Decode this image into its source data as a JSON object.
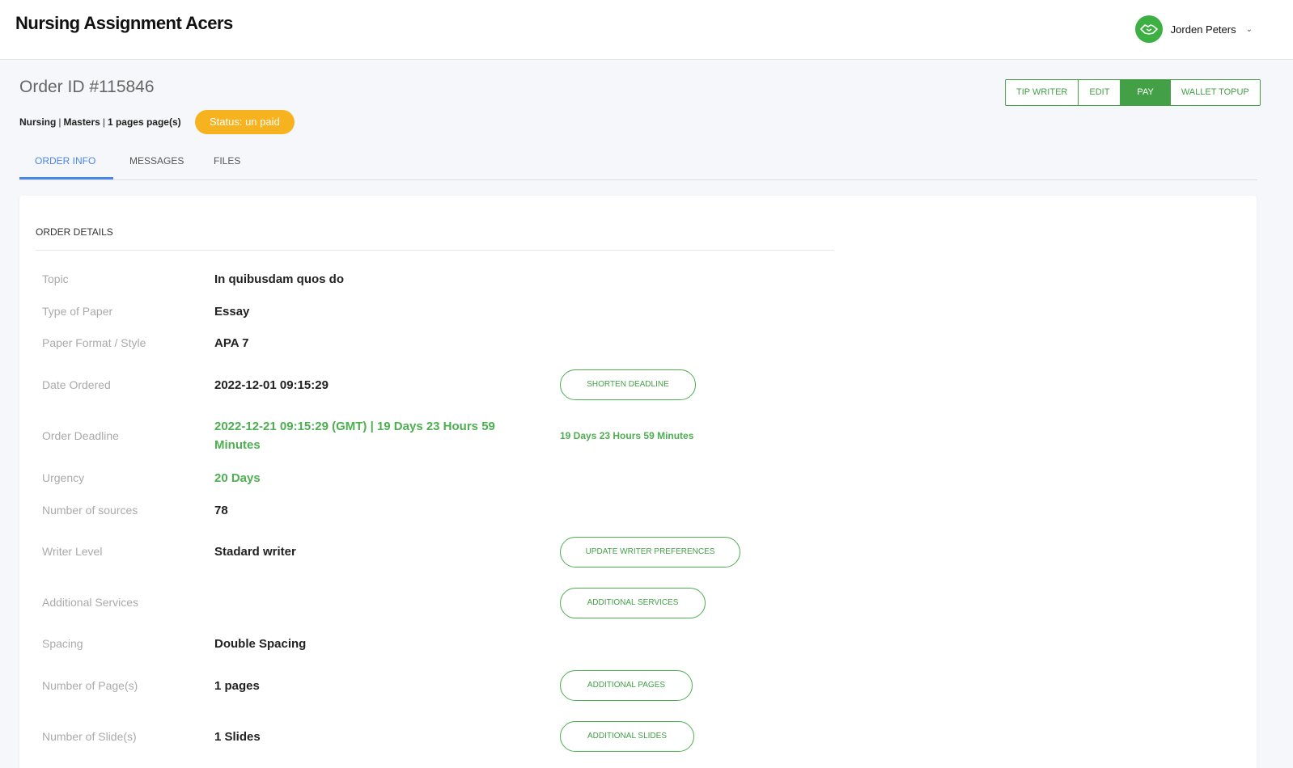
{
  "header": {
    "brand": "Nursing Assignment Acers",
    "user_name": "Jorden Peters",
    "avatar_icon": "handshake-icon",
    "menu_icon": "chevron-down-icon"
  },
  "order": {
    "title": "Order ID #115846",
    "subject": "Nursing",
    "level": "Masters",
    "pages": "1 pages page(s)",
    "separator": "|",
    "status": "Status: un paid"
  },
  "actions": {
    "tip_writer": "TIP WRITER",
    "edit": "EDIT",
    "pay": "PAY",
    "wallet_topup": "WALLET TOPUP"
  },
  "tabs": {
    "order_info": "ORDER INFO",
    "messages": "MESSAGES",
    "files": "FILES"
  },
  "details": {
    "section_title": "ORDER DETAILS",
    "topic_label": "Topic",
    "topic_value": "In quibusdam quos do",
    "paper_type_label": "Type of Paper",
    "paper_type_value": "Essay",
    "format_label": "Paper Format / Style",
    "format_value": "APA 7",
    "date_ordered_label": "Date Ordered",
    "date_ordered_value": "2022-12-01 09:15:29",
    "deadline_label": "Order Deadline",
    "deadline_value": "2022-12-21 09:15:29 (GMT) | 19 Days 23 Hours 59 Minutes",
    "countdown": "19 Days 23 Hours 59 Minutes",
    "urgency_label": "Urgency",
    "urgency_value": "20 Days",
    "sources_label": "Number of sources",
    "sources_value": "78",
    "writer_level_label": "Writer Level",
    "writer_level_value": "Stadard writer",
    "additional_services_label": "Additional Services",
    "spacing_label": "Spacing",
    "spacing_value": "Double Spacing",
    "pages_label": "Number of Page(s)",
    "pages_value": "1 pages",
    "slides_label": "Number of Slide(s)",
    "slides_value": "1 Slides"
  },
  "buttons": {
    "shorten_deadline": "SHORTEN DEADLINE",
    "update_writer_preferences": "UPDATE WRITER PREFERENCES",
    "additional_services": "ADDITIONAL SERVICES",
    "additional_pages": "ADDITIONAL PAGES",
    "additional_slides": "ADDITIONAL SLIDES"
  },
  "colors": {
    "accent_green": "#43a047",
    "status_amber": "#f7b31f",
    "tab_blue": "#4a86e8"
  }
}
